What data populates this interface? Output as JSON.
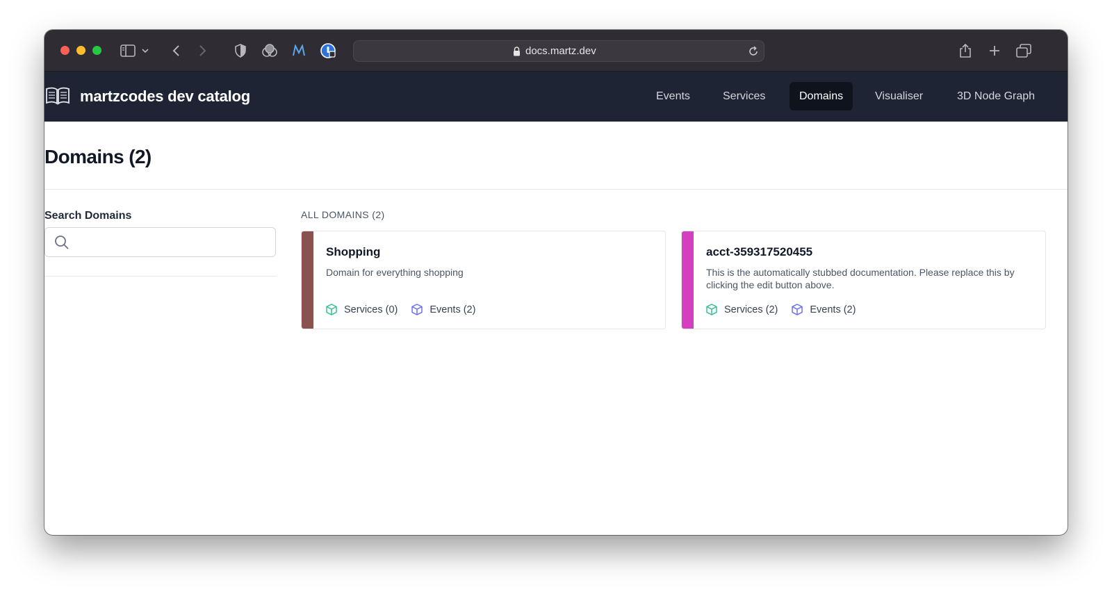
{
  "browser": {
    "url": "docs.martz.dev"
  },
  "header": {
    "brand": "martzcodes dev catalog",
    "nav": [
      {
        "label": "Events",
        "active": false
      },
      {
        "label": "Services",
        "active": false
      },
      {
        "label": "Domains",
        "active": true
      },
      {
        "label": "Visualiser",
        "active": false
      },
      {
        "label": "3D Node Graph",
        "active": false
      }
    ]
  },
  "page": {
    "title": "Domains (2)",
    "search_label": "Search Domains",
    "search_value": "",
    "section_label": "ALL DOMAINS (2)"
  },
  "domains": [
    {
      "name": "Shopping",
      "description": "Domain for everything shopping",
      "color": "#8a524e",
      "services_label": "Services (0)",
      "events_label": "Events (2)"
    },
    {
      "name": "acct-359317520455",
      "description": "This is the automatically stubbed documentation. Please replace this by clicking the edit button above.",
      "color": "#d43fc0",
      "services_label": "Services (2)",
      "events_label": "Events (2)"
    }
  ],
  "colors": {
    "header_bg": "#1e2433",
    "services_icon": "#34c38f",
    "events_icon": "#6b72ef"
  }
}
